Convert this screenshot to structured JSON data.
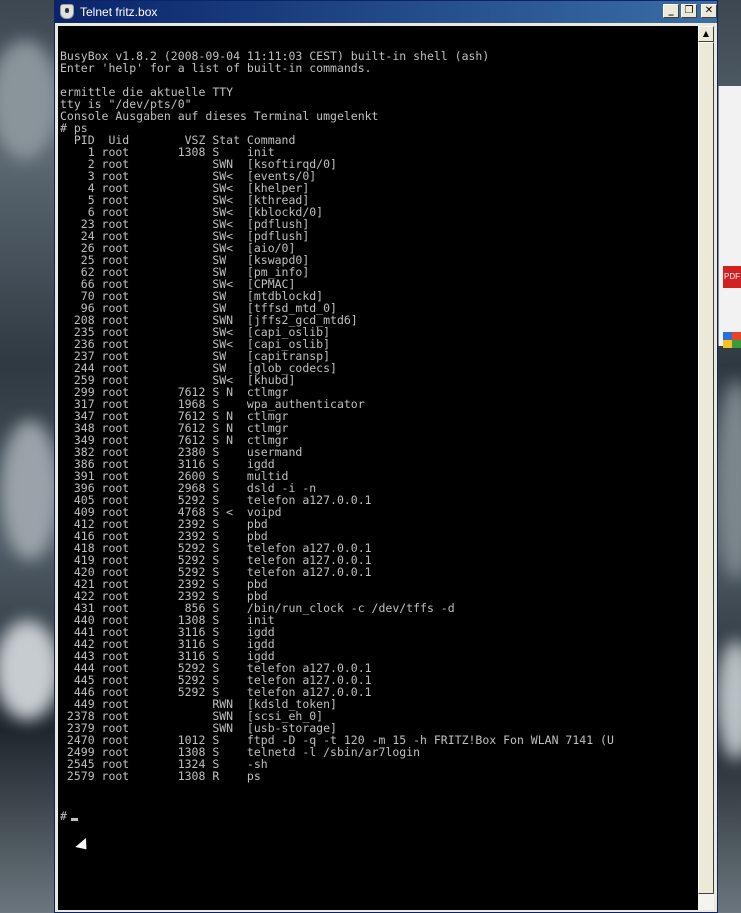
{
  "window": {
    "title": "Telnet fritz.box",
    "min_glyph": "_",
    "max_glyph": "❐",
    "close_glyph": "✕"
  },
  "scrollbar": {
    "up_glyph": "▲"
  },
  "background": {
    "pdf_label": "PDF"
  },
  "terminal": {
    "lines": [
      "BusyBox v1.8.2 (2008-09-04 11:11:03 CEST) built-in shell (ash)",
      "Enter 'help' for a list of built-in commands.",
      "",
      "ermittle die aktuelle TTY",
      "tty is \"/dev/pts/0\"",
      "Console Ausgaben auf dieses Terminal umgelenkt",
      "# ps",
      "  PID  Uid        VSZ Stat Command",
      "    1 root       1308 S    init",
      "    2 root            SWN  [ksoftirqd/0]",
      "    3 root            SW<  [events/0]",
      "    4 root            SW<  [khelper]",
      "    5 root            SW<  [kthread]",
      "    6 root            SW<  [kblockd/0]",
      "   23 root            SW<  [pdflush]",
      "   24 root            SW<  [pdflush]",
      "   26 root            SW<  [aio/0]",
      "   25 root            SW   [kswapd0]",
      "   62 root            SW   [pm_info]",
      "   66 root            SW<  [CPMAC]",
      "   70 root            SW   [mtdblockd]",
      "   96 root            SW   [tffsd_mtd_0]",
      "  208 root            SWN  [jffs2_gcd_mtd6]",
      "  235 root            SW<  [capi_oslib]",
      "  236 root            SW<  [capi_oslib]",
      "  237 root            SW   [capitransp]",
      "  244 root            SW   [glob_codecs]",
      "  259 root            SW<  [khubd]",
      "  299 root       7612 S N  ctlmgr",
      "  317 root       1968 S    wpa_authenticator",
      "  347 root       7612 S N  ctlmgr",
      "  348 root       7612 S N  ctlmgr",
      "  349 root       7612 S N  ctlmgr",
      "  382 root       2380 S    usermand",
      "  386 root       3116 S    igdd",
      "  391 root       2600 S    multid",
      "  396 root       2968 S    dsld -i -n",
      "  405 root       5292 S    telefon a127.0.0.1",
      "  409 root       4768 S <  voipd",
      "  412 root       2392 S    pbd",
      "  416 root       2392 S    pbd",
      "  418 root       5292 S    telefon a127.0.0.1",
      "  419 root       5292 S    telefon a127.0.0.1",
      "  420 root       5292 S    telefon a127.0.0.1",
      "  421 root       2392 S    pbd",
      "  422 root       2392 S    pbd",
      "  431 root        856 S    /bin/run_clock -c /dev/tffs -d",
      "  440 root       1308 S    init",
      "  441 root       3116 S    igdd",
      "  442 root       3116 S    igdd",
      "  443 root       3116 S    igdd",
      "  444 root       5292 S    telefon a127.0.0.1",
      "  445 root       5292 S    telefon a127.0.0.1",
      "  446 root       5292 S    telefon a127.0.0.1",
      "  449 root            RWN  [kdsld_token]",
      " 2378 root            SWN  [scsi_eh_0]",
      " 2379 root            SWN  [usb-storage]",
      " 2470 root       1012 S    ftpd -D -q -t 120 -m 15 -h FRITZ!Box Fon WLAN 7141 (U",
      " 2499 root       1308 S    telnetd -l /sbin/ar7login",
      " 2545 root       1324 S    -sh",
      " 2579 root       1308 R    ps"
    ],
    "prompt": "#"
  }
}
